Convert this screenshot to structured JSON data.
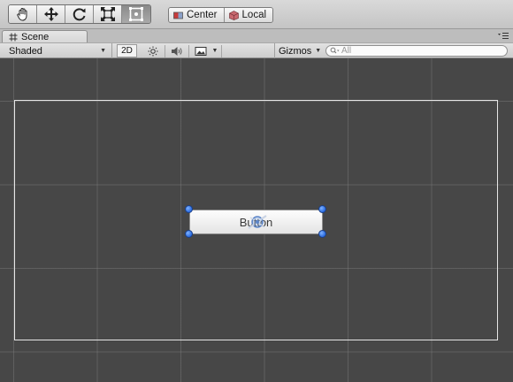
{
  "toolbar": {
    "tools": [
      {
        "name": "hand-tool",
        "icon": "hand-icon",
        "active": false
      },
      {
        "name": "move-tool",
        "icon": "move-arrows-icon",
        "active": false
      },
      {
        "name": "rotate-tool",
        "icon": "rotate-icon",
        "active": false
      },
      {
        "name": "scale-tool",
        "icon": "scale-icon",
        "active": false
      },
      {
        "name": "rect-tool",
        "icon": "rect-transform-icon",
        "active": true
      }
    ],
    "pivot_label": "Center",
    "space_label": "Local"
  },
  "tabs": {
    "scene_label": "Scene",
    "scene_icon": "grid-hash-icon",
    "menu_icon": "tab-menu-icon"
  },
  "scene_bar": {
    "shading_mode": "Shaded",
    "mode_2d_label": "2D",
    "lighting_icon": "sun-icon",
    "audio_icon": "speaker-icon",
    "effects_icon": "image-icon",
    "gizmos_label": "Gizmos",
    "search_placeholder": "All"
  },
  "scene": {
    "button_label": "Button",
    "colors": {
      "background": "#474747",
      "grid": "#7d7d7d",
      "canvas_outline": "#e6e6e6",
      "handle": "#2a6be0"
    }
  }
}
